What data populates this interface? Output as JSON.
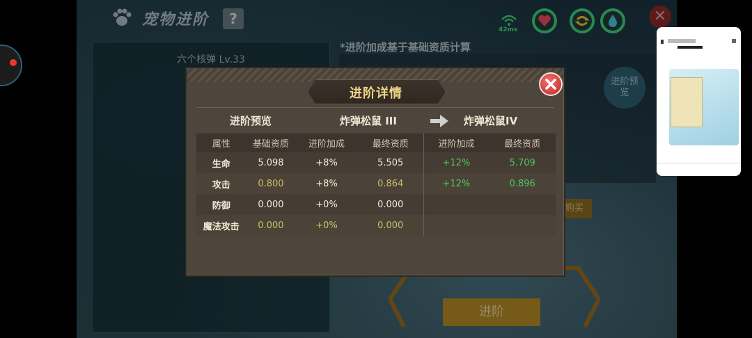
{
  "header": {
    "title": "宠物进阶",
    "help_label": "?",
    "ping": "42ms"
  },
  "left_panel": {
    "pet_name": "六个核弹 Lv.33"
  },
  "background": {
    "note": "*进阶加成基于基础资质计算",
    "advance_preview_label": "进阶预览",
    "buy_label": "购买",
    "advance_button_label": "进阶"
  },
  "modal": {
    "title": "进阶详情",
    "preview_label": "进阶预览",
    "from_pet": "炸弹松鼠 III",
    "to_pet": "炸弹松鼠IV",
    "columns": [
      "属性",
      "基础资质",
      "进阶加成",
      "最终资质",
      "进阶加成",
      "最终资质"
    ],
    "rows": [
      {
        "attr": "生命",
        "base": "5.098",
        "bonus": "+8%",
        "final": "5.505",
        "next_bonus": "+12%",
        "next_final": "5.709"
      },
      {
        "attr": "攻击",
        "base": "0.800",
        "bonus": "+8%",
        "final": "0.864",
        "next_bonus": "+12%",
        "next_final": "0.896"
      },
      {
        "attr": "防御",
        "base": "0.000",
        "bonus": "+0%",
        "final": "0.000",
        "next_bonus": "",
        "next_final": ""
      },
      {
        "attr": "魔法攻击",
        "base": "0.000",
        "bonus": "+0%",
        "final": "0.000",
        "next_bonus": "",
        "next_final": ""
      }
    ]
  },
  "colors": {
    "accent_gold": "#f0d48a",
    "positive_green": "#4fc95a",
    "close_red": "#d03030"
  },
  "icons": [
    "paw-icon",
    "signal-icon",
    "heart-icon",
    "exchange-icon",
    "water-drop-icon",
    "close-icon",
    "arrow-right-icon"
  ]
}
